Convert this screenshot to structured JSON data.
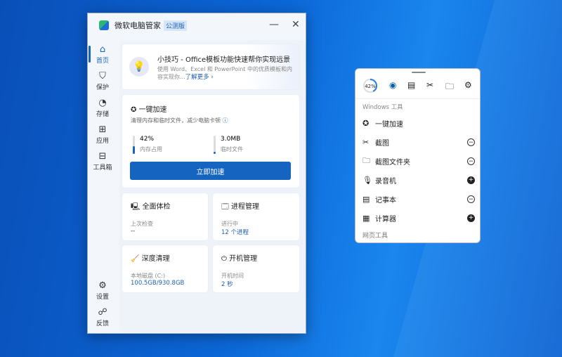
{
  "app": {
    "title": "微软电脑管家",
    "badge": "公测版",
    "minimize": "—",
    "close": "✕"
  },
  "sidebar": {
    "items": [
      {
        "label": "首页",
        "icon": "home-icon",
        "glyph": "⌂"
      },
      {
        "label": "保护",
        "icon": "shield-icon",
        "glyph": "⛉"
      },
      {
        "label": "存储",
        "icon": "pie-icon",
        "glyph": "◔"
      },
      {
        "label": "应用",
        "icon": "apps-icon",
        "glyph": "⊞"
      },
      {
        "label": "工具箱",
        "icon": "toolbox-icon",
        "glyph": "⊟"
      }
    ],
    "bottom": [
      {
        "label": "设置",
        "icon": "gear-icon",
        "glyph": "⚙"
      },
      {
        "label": "反馈",
        "icon": "feedback-icon",
        "glyph": "☍"
      }
    ]
  },
  "tip": {
    "title": "小技巧 - Office模板功能快速帮你实现远景",
    "body": "使用 Word、Excel 和 PowerPoint 中的优质模板和内容实现你...",
    "link": "了解更多 ›"
  },
  "boost": {
    "title": "一键加速",
    "desc": "清理内存和临时文件，减少电脑卡顿",
    "memory_value": "42%",
    "memory_label": "内存占用",
    "memory_fraction": 0.42,
    "temp_value": "3.0MB",
    "temp_label": "临时文件",
    "temp_fraction": 0.1,
    "button": "立即加速"
  },
  "tiles": [
    {
      "title": "全面体检",
      "label": "上次检查",
      "value": "--"
    },
    {
      "title": "进程管理",
      "label": "进行中",
      "value": "12 个进程"
    },
    {
      "title": "深度清理",
      "label": "本地磁盘 (C:)",
      "value": "100.5GB/930.8GB"
    },
    {
      "title": "开机管理",
      "label": "开机时间",
      "value": "2 秒"
    }
  ],
  "widget": {
    "memory": "42%",
    "memory_fraction": 0.42,
    "section": "Windows 工具",
    "items": [
      {
        "label": "一键加速",
        "glyph": "✪",
        "action": ""
      },
      {
        "label": "截图",
        "glyph": "✂",
        "action": "−"
      },
      {
        "label": "截图文件夹",
        "glyph": "🗀",
        "action": "−"
      },
      {
        "label": "录音机",
        "glyph": "🎙",
        "action": "+"
      },
      {
        "label": "记事本",
        "glyph": "▤",
        "action": "−"
      },
      {
        "label": "计算器",
        "glyph": "▦",
        "action": "+"
      }
    ],
    "next_section": "网页工具"
  },
  "colors": {
    "accent": "#1565c0"
  }
}
